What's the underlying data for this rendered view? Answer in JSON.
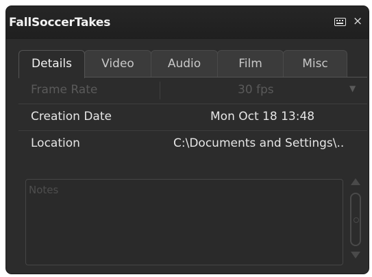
{
  "window": {
    "title": "FallSoccerTakes"
  },
  "icons": {
    "keyboard": "keyboard-icon",
    "close": "close-icon"
  },
  "tabs": [
    {
      "label": "Details",
      "active": true
    },
    {
      "label": "Video",
      "active": false
    },
    {
      "label": "Audio",
      "active": false
    },
    {
      "label": "Film",
      "active": false
    },
    {
      "label": "Misc",
      "active": false
    }
  ],
  "details": {
    "frame_rate": {
      "label": "Frame Rate",
      "value": "30 fps",
      "disabled": true
    },
    "creation_date": {
      "label": "Creation Date",
      "value": "Mon Oct 18 13:48"
    },
    "location": {
      "label": "Location",
      "value": "C:\\Documents and Settings\\.."
    },
    "notes": {
      "placeholder": "Notes"
    }
  },
  "colors": {
    "background": "#2c2c2c",
    "title_text": "#f2f2f2",
    "disabled_text": "#5a5a5a"
  }
}
